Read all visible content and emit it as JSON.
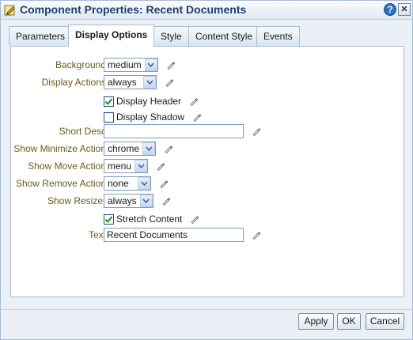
{
  "window": {
    "title": "Component Properties: Recent Documents",
    "help_glyph": "?",
    "close_glyph": "✕",
    "icon": "properties-icon"
  },
  "tabs": [
    {
      "label": "Parameters",
      "active": false
    },
    {
      "label": "Display Options",
      "active": true
    },
    {
      "label": "Style",
      "active": false
    },
    {
      "label": "Content Style",
      "active": false
    },
    {
      "label": "Events",
      "active": false
    }
  ],
  "form": {
    "background": {
      "label": "Background",
      "value": "medium"
    },
    "display_actions": {
      "label": "Display Actions",
      "value": "always"
    },
    "display_header": {
      "label": "Display Header",
      "checked": true
    },
    "display_shadow": {
      "label": "Display Shadow",
      "checked": false
    },
    "short_desc": {
      "label": "Short Desc",
      "value": ""
    },
    "show_minimize_action": {
      "label": "Show Minimize Action",
      "value": "chrome"
    },
    "show_move_action": {
      "label": "Show Move Action",
      "value": "menu"
    },
    "show_remove_action": {
      "label": "Show Remove Action",
      "value": "none"
    },
    "show_resizer": {
      "label": "Show Resizer",
      "value": "always"
    },
    "stretch_content": {
      "label": "Stretch Content",
      "checked": true
    },
    "text": {
      "label": "Text",
      "value": "Recent Documents"
    }
  },
  "buttons": {
    "apply": "Apply",
    "ok": "OK",
    "cancel": "Cancel"
  },
  "colors": {
    "label": "#6b5a1a",
    "title": "#21406a",
    "accent": "#2f6fc0",
    "check": "#1f8a1f"
  },
  "icons": {
    "edit": "pencil-icon",
    "dropdown": "chevron-down-icon",
    "check": "checkmark-icon"
  }
}
